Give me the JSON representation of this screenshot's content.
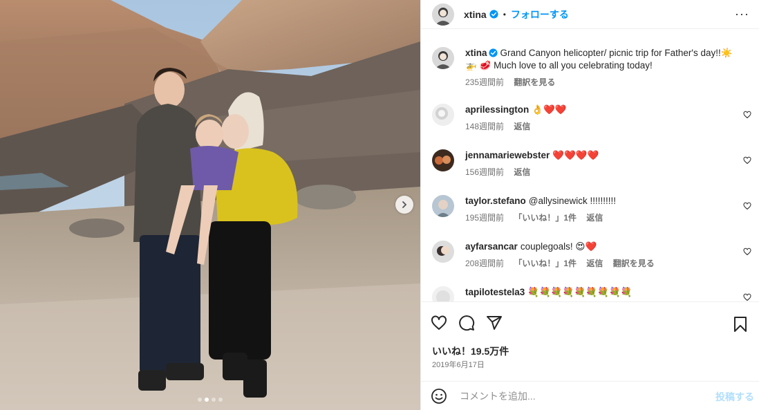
{
  "header": {
    "username": "xtina",
    "separator": "•",
    "follow_label": "フォローする",
    "more_label": "···"
  },
  "caption": {
    "username": "xtina",
    "text_line1": "Grand Canyon helicopter/ picnic trip for Father's day!!☀️",
    "text_line2": "🚁 🥩 Much love to all you celebrating today!",
    "time": "235週間前",
    "translate": "翻訳を見る"
  },
  "comments": [
    {
      "username": "aprilessington",
      "text": "👌❤️❤️",
      "time": "148週間前",
      "likes": "",
      "reply": "返信",
      "translate": ""
    },
    {
      "username": "jennamariewebster",
      "text": "❤️❤️❤️❤️",
      "time": "156週間前",
      "likes": "",
      "reply": "返信",
      "translate": ""
    },
    {
      "username": "taylor.stefano",
      "text": "@allysinewick !!!!!!!!!!",
      "time": "195週間前",
      "likes": "「いいね！」1件",
      "reply": "返信",
      "translate": ""
    },
    {
      "username": "ayfarsancar",
      "text": "couplegoals! 😍❤️",
      "time": "208週間前",
      "likes": "「いいね！」1件",
      "reply": "返信",
      "translate": "翻訳を見る"
    },
    {
      "username": "tapilotestela3",
      "text": "💐💐💐💐💐💐💐💐💐",
      "time": "",
      "likes": "",
      "reply": "",
      "translate": ""
    }
  ],
  "post_stats": {
    "likes": "いいね！19.5万件",
    "date": "2019年6月17日"
  },
  "add_comment": {
    "placeholder": "コメントを追加...",
    "post_label": "投稿する"
  },
  "carousel": {
    "dots": 4,
    "active_index": 1
  },
  "colors": {
    "accent": "#0095f6",
    "muted": "#737373",
    "post_disabled": "#b2dffc"
  }
}
